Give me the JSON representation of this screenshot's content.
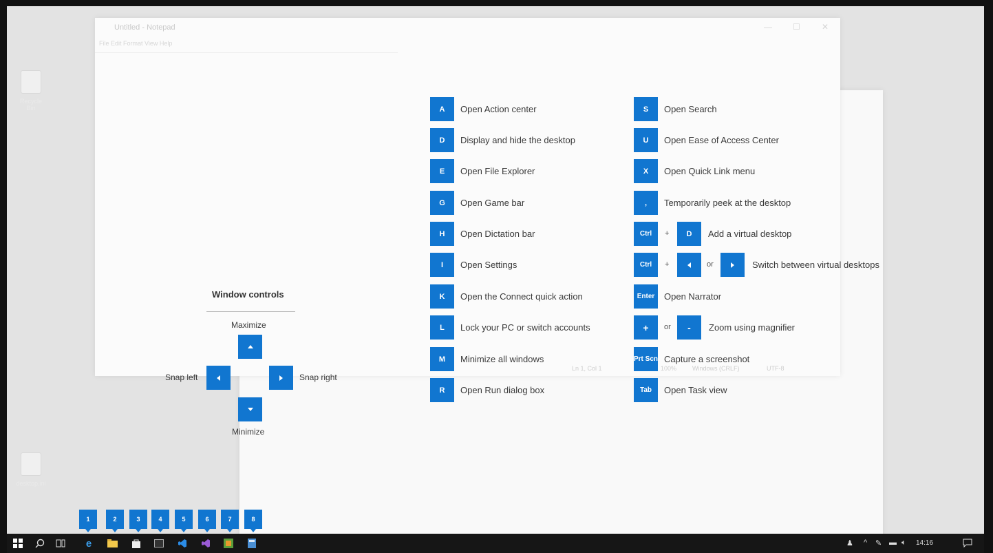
{
  "desktop": {
    "icons": [
      {
        "label": "Recycle Bin"
      },
      {
        "label": "desktop.ini"
      }
    ]
  },
  "notepad": {
    "title": "Untitled - Notepad",
    "menu": "File  Edit  Format  View  Help",
    "status": {
      "position": "Ln 1, Col 1",
      "zoom": "100%",
      "line_endings": "Windows (CRLF)",
      "encoding": "UTF-8"
    }
  },
  "shortcuts_left": [
    {
      "key": "A",
      "desc": "Open Action center"
    },
    {
      "key": "D",
      "desc": "Display and hide the desktop"
    },
    {
      "key": "E",
      "desc": "Open File Explorer"
    },
    {
      "key": "G",
      "desc": "Open Game bar"
    },
    {
      "key": "H",
      "desc": "Open Dictation bar"
    },
    {
      "key": "I",
      "desc": "Open Settings"
    },
    {
      "key": "K",
      "desc": "Open the Connect quick action"
    },
    {
      "key": "L",
      "desc": "Lock your PC or switch accounts"
    },
    {
      "key": "M",
      "desc": "Minimize all windows"
    },
    {
      "key": "R",
      "desc": "Open Run dialog box"
    }
  ],
  "shortcuts_right": {
    "s": {
      "key": "S",
      "desc": "Open Search"
    },
    "u": {
      "key": "U",
      "desc": "Open Ease of Access Center"
    },
    "x": {
      "key": "X",
      "desc": "Open Quick Link menu"
    },
    "comma": {
      "key": ",",
      "desc": "Temporarily peek at the desktop"
    },
    "ctrl_d": {
      "key1": "Ctrl",
      "plus": "+",
      "key2": "D",
      "desc": "Add a virtual desktop"
    },
    "ctrl_arrows": {
      "key1": "Ctrl",
      "plus": "+",
      "or": "or",
      "desc": "Switch between virtual desktops"
    },
    "enter": {
      "key": "Enter",
      "desc": "Open Narrator"
    },
    "zoom": {
      "key1": "+",
      "or": "or",
      "key2": "-",
      "desc": "Zoom using magnifier"
    },
    "prtscn": {
      "key": "Prt Scn",
      "desc": "Capture a screenshot"
    },
    "tab": {
      "key": "Tab",
      "desc": "Open Task view"
    }
  },
  "window_controls": {
    "title": "Window controls",
    "maximize": "Maximize",
    "minimize": "Minimize",
    "snap_left": "Snap left",
    "snap_right": "Snap right"
  },
  "taskbar": {
    "numbers": [
      "1",
      "2",
      "3",
      "4",
      "5",
      "6",
      "7",
      "8"
    ],
    "time": "14:16",
    "accent": "#1176d0"
  }
}
